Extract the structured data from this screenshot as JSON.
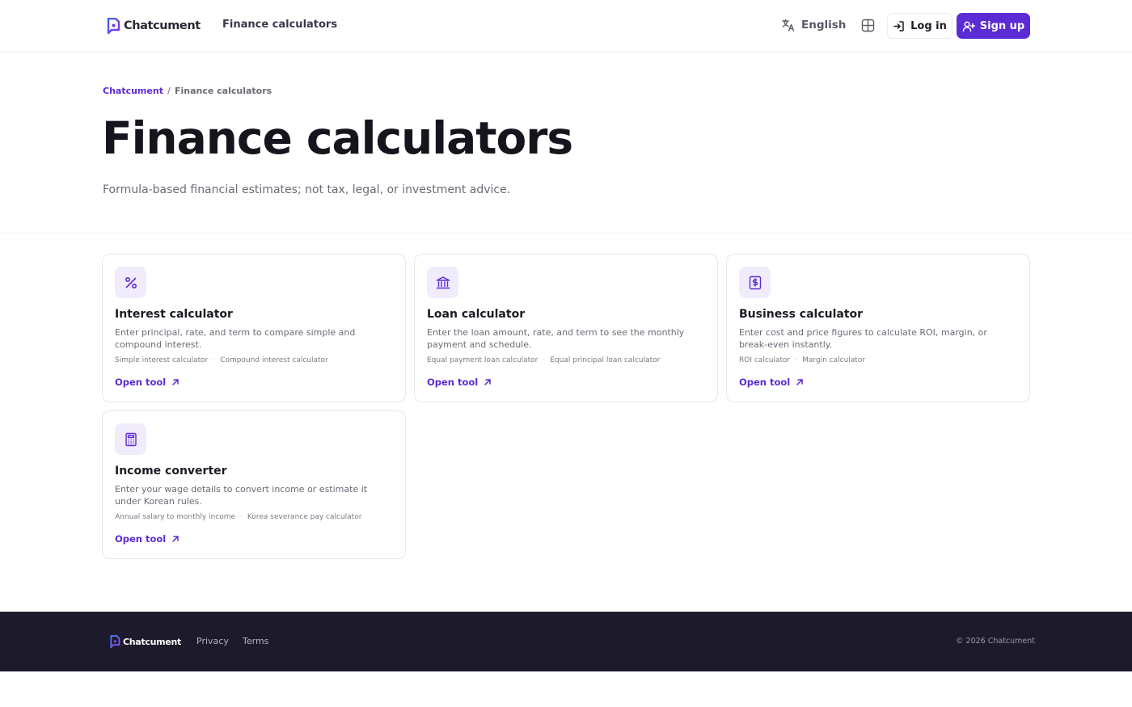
{
  "header": {
    "brand": "Chatcument",
    "nav_link": "Finance calculators",
    "language": "English",
    "login_label": "Log in",
    "signup_label": "Sign up"
  },
  "breadcrumb": {
    "home": "Chatcument",
    "separator": "/",
    "current": "Finance calculators"
  },
  "hero": {
    "title": "Finance calculators",
    "subtitle": "Formula-based financial estimates; not tax, legal, or investment advice."
  },
  "cards": [
    {
      "icon": "percent-icon",
      "title": "Interest calculator",
      "description": "Enter principal, rate, and term to compare simple and compound interest.",
      "tags": [
        "Simple interest calculator",
        "Compound interest calculator"
      ],
      "cta": "Open tool"
    },
    {
      "icon": "bank-icon",
      "title": "Loan calculator",
      "description": "Enter the loan amount, rate, and term to see the monthly payment and schedule.",
      "tags": [
        "Equal payment loan calculator",
        "Equal principal loan calculator"
      ],
      "cta": "Open tool"
    },
    {
      "icon": "receipt-dollar-icon",
      "title": "Business calculator",
      "description": "Enter cost and price figures to calculate ROI, margin, or break-even instantly.",
      "tags": [
        "ROI calculator",
        "Margin calculator"
      ],
      "cta": "Open tool"
    },
    {
      "icon": "calculator-icon",
      "title": "Income converter",
      "description": "Enter your wage details to convert income or estimate it under Korean rules.",
      "tags": [
        "Annual salary to monthly income",
        "Korea severance pay calculator"
      ],
      "cta": "Open tool"
    }
  ],
  "footer": {
    "brand": "Chatcument",
    "privacy": "Privacy",
    "terms": "Terms",
    "copyright": "© 2026 Chatcument"
  },
  "colors": {
    "accent": "#5b2bd6",
    "footer_bg": "#1d1a2b",
    "icon_bg": "#f1ecfc"
  }
}
